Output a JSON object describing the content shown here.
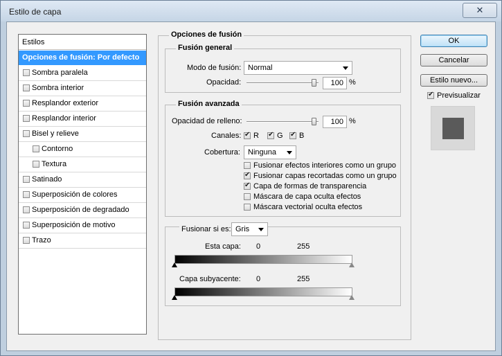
{
  "window": {
    "title": "Estilo de capa",
    "close_glyph": "✕"
  },
  "styles_panel": {
    "header": "Estilos",
    "selected": "Opciones de fusión: Por defecto",
    "items": [
      {
        "label": "Sombra paralela",
        "checked": false
      },
      {
        "label": "Sombra interior",
        "checked": false
      },
      {
        "label": "Resplandor exterior",
        "checked": false
      },
      {
        "label": "Resplandor interior",
        "checked": false
      },
      {
        "label": "Bisel y relieve",
        "checked": false
      },
      {
        "label": "Contorno",
        "checked": false
      },
      {
        "label": "Textura",
        "checked": false
      },
      {
        "label": "Satinado",
        "checked": false
      },
      {
        "label": "Superposición de colores",
        "checked": false
      },
      {
        "label": "Superposición de degradado",
        "checked": false
      },
      {
        "label": "Superposición de motivo",
        "checked": false
      },
      {
        "label": "Trazo",
        "checked": false
      }
    ]
  },
  "blend": {
    "section_title": "Opciones de fusión",
    "general": {
      "title": "Fusión general",
      "mode_label": "Modo de fusión:",
      "mode_value": "Normal",
      "opacity_label": "Opacidad:",
      "opacity_value": "100",
      "opacity_unit": "%"
    },
    "advanced": {
      "title": "Fusión avanzada",
      "fill_label": "Opacidad de relleno:",
      "fill_value": "100",
      "fill_unit": "%",
      "channels_label": "Canales:",
      "channels": [
        {
          "label": "R",
          "checked": true
        },
        {
          "label": "G",
          "checked": true
        },
        {
          "label": "B",
          "checked": true
        }
      ],
      "knockout_label": "Cobertura:",
      "knockout_value": "Ninguna",
      "options": [
        {
          "label": "Fusionar efectos interiores como un grupo",
          "checked": false
        },
        {
          "label": "Fusionar capas recortadas como un grupo",
          "checked": true
        },
        {
          "label": "Capa de formas de transparencia",
          "checked": true
        },
        {
          "label": "Máscara de capa oculta efectos",
          "checked": false
        },
        {
          "label": "Máscara vectorial oculta efectos",
          "checked": false
        }
      ]
    },
    "blend_if": {
      "label": "Fusionar si es:",
      "value": "Gris",
      "this_layer": {
        "label": "Esta capa:",
        "min": "0",
        "max": "255"
      },
      "underlying": {
        "label": "Capa subyacente:",
        "min": "0",
        "max": "255"
      }
    }
  },
  "buttons": {
    "ok": "OK",
    "cancel": "Cancelar",
    "new_style": "Estilo nuevo...",
    "preview_label": "Previsualizar",
    "preview_checked": true
  },
  "colors": {
    "selection": "#3399ff",
    "preview_swatch": "#5a5a5a"
  }
}
